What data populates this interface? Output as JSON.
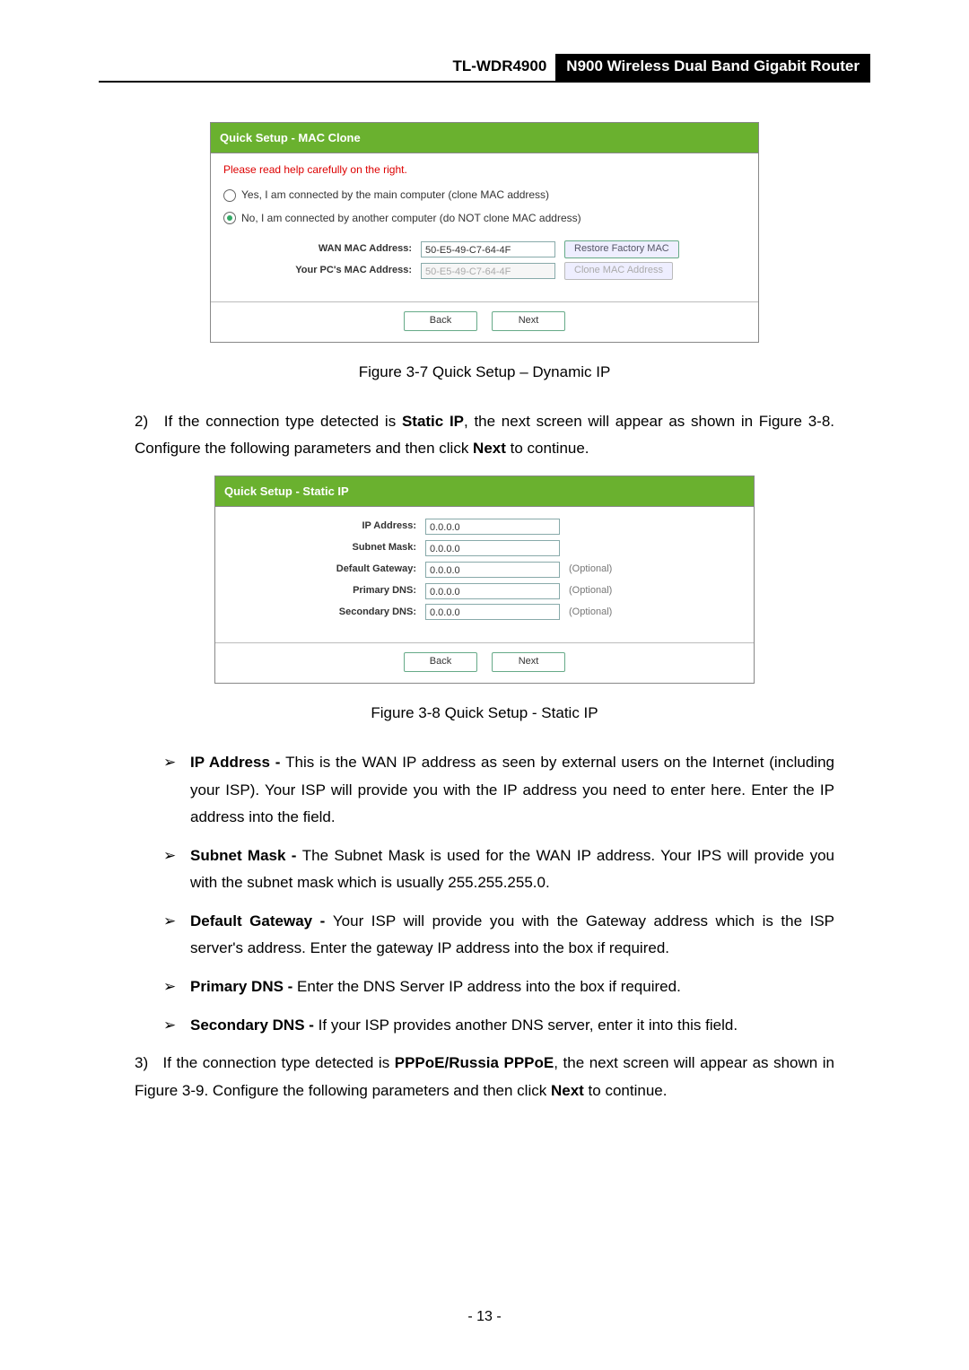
{
  "header": {
    "model": "TL-WDR4900",
    "title": "N900 Wireless Dual Band Gigabit Router"
  },
  "fig1": {
    "title": "Quick Setup - MAC Clone",
    "note": "Please read help carefully on the right.",
    "opt_yes": "Yes, I am connected by the main computer (clone MAC address)",
    "opt_no": "No, I am connected by another computer (do NOT clone MAC address)",
    "lbl_wan": "WAN MAC Address:",
    "val_wan": "50-E5-49-C7-64-4F",
    "btn_restore": "Restore Factory MAC",
    "lbl_pc": "Your PC's MAC Address:",
    "val_pc": "50-E5-49-C7-64-4F",
    "btn_clone": "Clone MAC Address",
    "back": "Back",
    "next": "Next",
    "caption": "Figure 3-7 Quick Setup – Dynamic IP"
  },
  "para2_a": "If the connection type detected is ",
  "para2_b": "Static IP",
  "para2_c": ", the next screen will appear as shown in Figure 3-8. Configure the following parameters and then click ",
  "para2_d": "Next",
  "para2_e": " to continue.",
  "fig2": {
    "title": "Quick Setup - Static IP",
    "rows": [
      {
        "label": "IP Address:",
        "value": "0.0.0.0",
        "hint": ""
      },
      {
        "label": "Subnet Mask:",
        "value": "0.0.0.0",
        "hint": ""
      },
      {
        "label": "Default Gateway:",
        "value": "0.0.0.0",
        "hint": "(Optional)"
      },
      {
        "label": "Primary DNS:",
        "value": "0.0.0.0",
        "hint": "(Optional)"
      },
      {
        "label": "Secondary DNS:",
        "value": "0.0.0.0",
        "hint": "(Optional)"
      }
    ],
    "back": "Back",
    "next": "Next",
    "caption": "Figure 3-8 Quick Setup - Static IP"
  },
  "bullets": [
    {
      "b": "IP Address - ",
      "t": "This is the WAN IP address as seen by external users on the Internet (including your ISP). Your ISP will provide you with the IP address you need to enter here. Enter the IP address into the field."
    },
    {
      "b": "Subnet Mask - ",
      "t": "The Subnet Mask is used for the WAN IP address. Your IPS will provide you with the subnet mask which is usually 255.255.255.0."
    },
    {
      "b": "Default Gateway - ",
      "t": "Your ISP will provide you with the Gateway address which is the ISP server's address. Enter the gateway IP address into the box if required."
    },
    {
      "b": "Primary DNS - ",
      "t": "Enter the DNS Server IP address into the box if required."
    },
    {
      "b": "Secondary DNS - ",
      "t": "If your ISP provides another DNS server, enter it into this field."
    }
  ],
  "para3_a": "If the connection type detected is ",
  "para3_b": "PPPoE/Russia PPPoE",
  "para3_c": ", the next screen will appear as shown in Figure 3-9. Configure the following parameters and then click ",
  "para3_d": "Next",
  "para3_e": " to continue.",
  "page_number": "- 13 -",
  "list_no2": "2)",
  "list_no3": "3)",
  "bullet_mark": "➢"
}
